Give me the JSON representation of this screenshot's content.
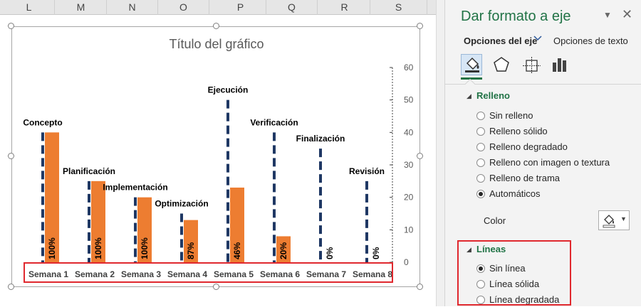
{
  "sheet": {
    "columns": [
      "L",
      "M",
      "N",
      "O",
      "P",
      "Q",
      "R",
      "S"
    ]
  },
  "chart": {
    "title": "Título del gráfico"
  },
  "chart_data": {
    "type": "bar",
    "categories": [
      "Semana 1",
      "Semana 2",
      "Semana 3",
      "Semana 4",
      "Semana 5",
      "Semana 6",
      "Semana 7",
      "Semana 8"
    ],
    "ylim": [
      0,
      60
    ],
    "yticks": [
      0,
      10,
      20,
      30,
      40,
      50,
      60
    ],
    "axis_position": "right",
    "series": [
      {
        "values": [
          40,
          25,
          20,
          13,
          23,
          8,
          0,
          0
        ],
        "color": "#ed7d31"
      },
      {
        "values": [
          40,
          25,
          20,
          15,
          50,
          40,
          35,
          25
        ],
        "color": "#1f3864",
        "style": "dashed"
      }
    ],
    "data_labels": [
      "100%",
      "100%",
      "100%",
      "87%",
      "46%",
      "20%",
      "0%",
      "0%"
    ],
    "phase_labels": [
      "Concepto",
      "Planificación",
      "Implementación",
      "Optimización",
      "Ejecución",
      "Verificación",
      "Finalización",
      "Revisión"
    ]
  },
  "pane": {
    "title": "Dar formato a eje",
    "tabs": {
      "axis_options": "Opciones del eje",
      "text_options": "Opciones de texto"
    },
    "fill": {
      "header": "Relleno",
      "options": [
        "Sin relleno",
        "Relleno sólido",
        "Relleno degradado",
        "Relleno con imagen o textura",
        "Relleno de trama",
        "Automáticos"
      ],
      "selected": 5
    },
    "color_label": "Color",
    "lines": {
      "header": "Líneas",
      "options": [
        "Sin línea",
        "Línea sólida",
        "Línea degradada"
      ],
      "selected": 0
    },
    "accent": "#217346"
  }
}
